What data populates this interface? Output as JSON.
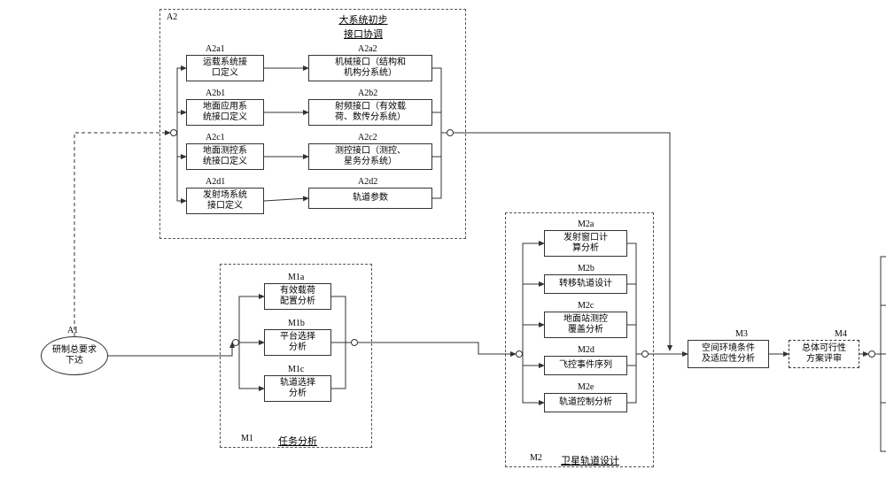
{
  "A1": {
    "label": "A1",
    "text": "研制总要求\n下达"
  },
  "A2": {
    "label": "A2",
    "title": "大系统初步\n接口协调",
    "A2a1": {
      "label": "A2a1",
      "text": "运载系统接\n口定义"
    },
    "A2a2": {
      "label": "A2a2",
      "text": "机械接口（结构和\n机构分系统）"
    },
    "A2b1": {
      "label": "A2b1",
      "text": "地面应用系\n统接口定义"
    },
    "A2b2": {
      "label": "A2b2",
      "text": "射频接口（有效载\n荷、数传分系统）"
    },
    "A2c1": {
      "label": "A2c1",
      "text": "地面测控系\n统接口定义"
    },
    "A2c2": {
      "label": "A2c2",
      "text": "测控接口（测控、\n星务分系统）"
    },
    "A2d1": {
      "label": "A2d1",
      "text": "发射场系统\n接口定义"
    },
    "A2d2": {
      "label": "A2d2",
      "text": "轨道参数"
    }
  },
  "M1": {
    "label": "M1",
    "title": "任务分析",
    "M1a": {
      "label": "M1a",
      "text": "有效载荷\n配置分析"
    },
    "M1b": {
      "label": "M1b",
      "text": "平台选择\n分析"
    },
    "M1c": {
      "label": "M1c",
      "text": "轨道选择\n分析"
    }
  },
  "M2": {
    "label": "M2",
    "title": "卫星轨道设计",
    "M2a": {
      "label": "M2a",
      "text": "发射窗口计\n算分析"
    },
    "M2b": {
      "label": "M2b",
      "text": "转移轨道设计"
    },
    "M2c": {
      "label": "M2c",
      "text": "地面站测控\n覆盖分析"
    },
    "M2d": {
      "label": "M2d",
      "text": "飞控事件序列"
    },
    "M2e": {
      "label": "M2e",
      "text": "轨道控制分析"
    }
  },
  "M3": {
    "label": "M3",
    "text": "空间环境条件\n及适应性分析"
  },
  "M4": {
    "label": "M4",
    "text": "总体可行性\n方案评审"
  }
}
